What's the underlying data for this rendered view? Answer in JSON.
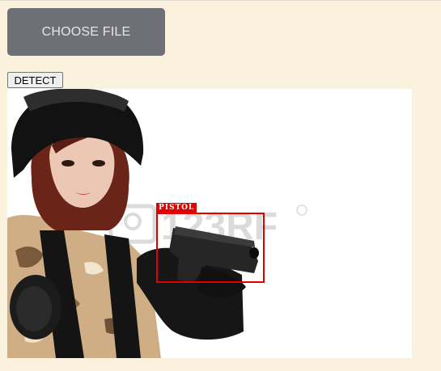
{
  "upload": {
    "choose_label": "CHOOSE FILE"
  },
  "actions": {
    "detect_label": "DETECT"
  },
  "detection": {
    "label": "PISTOL",
    "box_color": "#e00000"
  },
  "watermark": {
    "text": "123RF"
  }
}
